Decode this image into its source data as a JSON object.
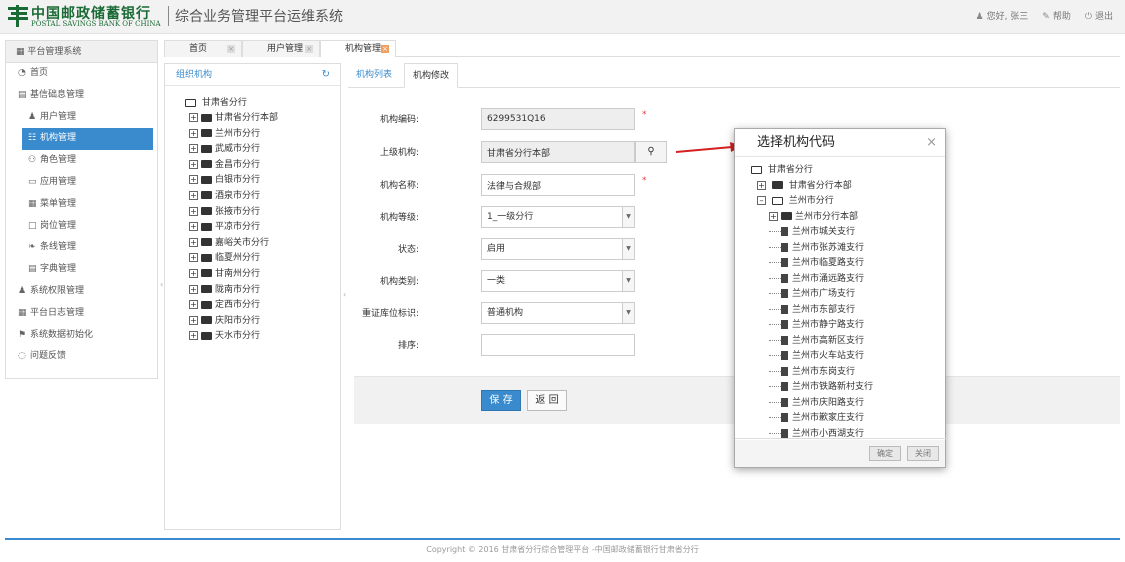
{
  "header": {
    "logo_cn": "中国邮政储蓄银行",
    "logo_en": "POSTAL SAVINGS BANK OF CHINA",
    "system_title": "综合业务管理平台运维系统",
    "greeting": "您好, 张三",
    "help": "帮助",
    "logout": "退出",
    "brand_color": "#1a6a35"
  },
  "sidebar": {
    "title": "平台管理系统",
    "items": [
      {
        "label": "首页",
        "icon": "dashboard-icon"
      },
      {
        "label": "基信础息管理",
        "icon": "book-icon"
      },
      {
        "label": "用户管理",
        "icon": "user-icon",
        "sub": true
      },
      {
        "label": "机构管理",
        "icon": "sitemap-icon",
        "sub": true,
        "active": true
      },
      {
        "label": "角色管理",
        "icon": "users-icon",
        "sub": true
      },
      {
        "label": "应用管理",
        "icon": "desktop-icon",
        "sub": true
      },
      {
        "label": "菜单管理",
        "icon": "calendar-icon",
        "sub": true
      },
      {
        "label": "岗位管理",
        "icon": "file-icon",
        "sub": true
      },
      {
        "label": "条线管理",
        "icon": "leaf-icon",
        "sub": true
      },
      {
        "label": "字典管理",
        "icon": "book-icon",
        "sub": true
      },
      {
        "label": "系统权限管理",
        "icon": "user-icon"
      },
      {
        "label": "平台日志管理",
        "icon": "calendar-icon"
      },
      {
        "label": "系统数据初始化",
        "icon": "flag-icon"
      },
      {
        "label": "问题反馈",
        "icon": "comment-icon"
      }
    ]
  },
  "tabs": [
    {
      "label": "首页",
      "active": false
    },
    {
      "label": "用户管理",
      "active": false
    },
    {
      "label": "机构管理",
      "active": true
    }
  ],
  "org_panel": {
    "title": "组织机构",
    "root": "甘肃省分行",
    "children": [
      "甘肃省分行本部",
      "兰州市分行",
      "武威市分行",
      "金昌市分行",
      "白银市分行",
      "酒泉市分行",
      "张掖市分行",
      "平凉市分行",
      "嘉峪关市分行",
      "临夏州分行",
      "甘南州分行",
      "陇南市分行",
      "定西市分行",
      "庆阳市分行",
      "天水市分行"
    ]
  },
  "subtabs": [
    {
      "label": "机构列表",
      "active": false
    },
    {
      "label": "机构修改",
      "active": true
    }
  ],
  "form": {
    "code_label": "机构编码:",
    "code_value": "6299531Q16",
    "parent_label": "上级机构:",
    "parent_value": "甘肃省分行本部",
    "name_label": "机构名称:",
    "name_value": "法律与合规部",
    "level_label": "机构等级:",
    "level_value": "1_一级分行",
    "status_label": "状态:",
    "status_value": "启用",
    "category_label": "机构类别:",
    "category_value": "一类",
    "vault_label": "重证库位标识:",
    "vault_value": "普通机构",
    "sort_label": "排序:",
    "sort_value": "",
    "required_mark": "*",
    "save_label": "保 存",
    "back_label": "返 回"
  },
  "modal": {
    "title": "选择机构代码",
    "close_glyph": "×",
    "root": "甘肃省分行",
    "top_nodes": [
      "甘肃省分行本部",
      "兰州市分行"
    ],
    "lanzhou_children": [
      "兰州市分行本部",
      "兰州市城关支行",
      "兰州市张苏滩支行",
      "兰州市临夏路支行",
      "兰州市涌远路支行",
      "兰州市广场支行",
      "兰州市东部支行",
      "兰州市静宁路支行",
      "兰州市高新区支行",
      "兰州市火车站支行",
      "兰州市东岗支行",
      "兰州市铁路新村支行",
      "兰州市庆阳路支行",
      "兰州市歉家庄支行",
      "兰州市小西湖支行"
    ],
    "ok_label": "确定",
    "close_label": "关闭"
  },
  "footer": {
    "text": "Copyright © 2016 甘肃省分行综合管理平台 -中国邮政储蓄银行甘肃省分行"
  },
  "colors": {
    "accent": "#3a8bcd",
    "required": "#e04040",
    "annotation_arrow": "#d42020"
  }
}
